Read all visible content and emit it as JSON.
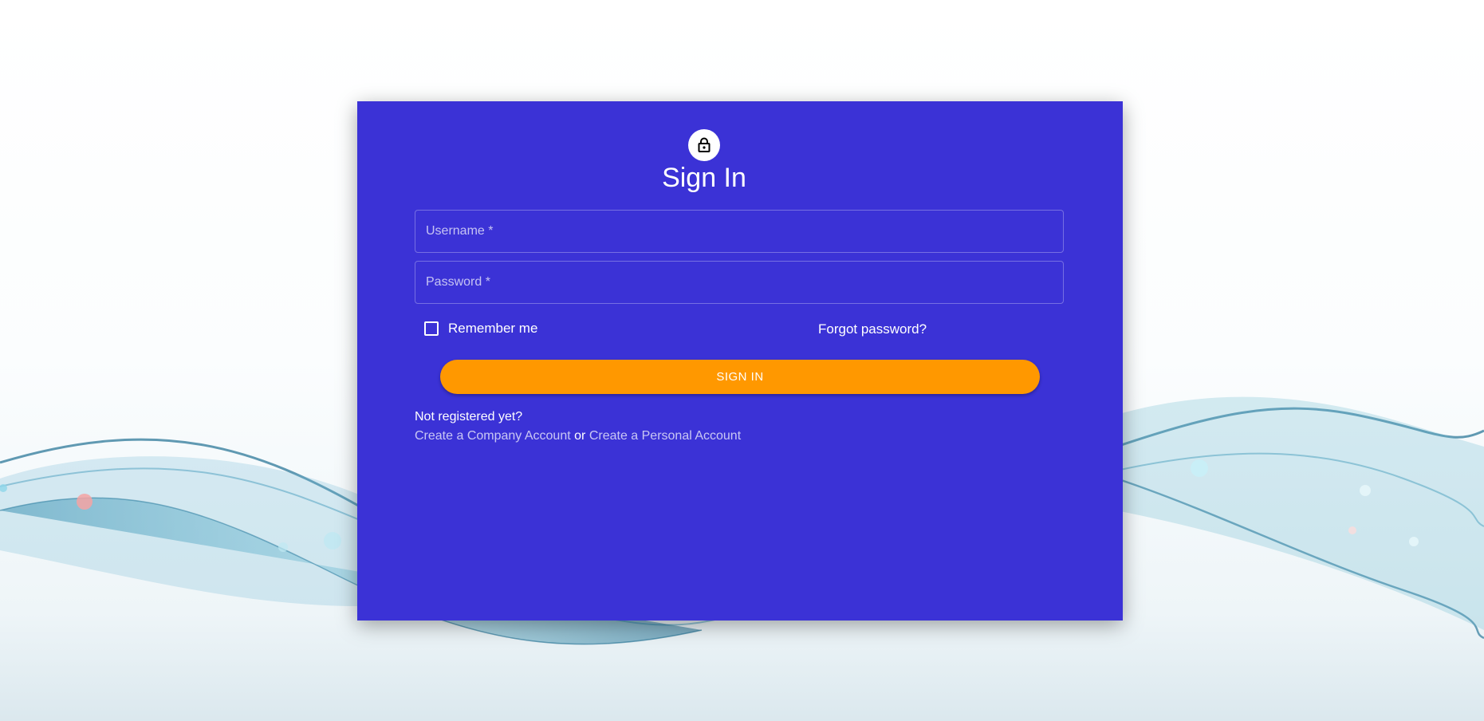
{
  "card": {
    "title": "Sign In",
    "lock_icon": "lock-icon"
  },
  "form": {
    "username_placeholder": "Username *",
    "password_placeholder": "Password *",
    "remember_label": "Remember me",
    "remember_checked": false,
    "forgot_label": "Forgot password?",
    "signin_label": "SIGN IN"
  },
  "register": {
    "prompt": "Not registered yet?",
    "company_link": "Create a Company Account",
    "separator": "or",
    "personal_link": "Create a Personal Account"
  },
  "colors": {
    "card_background": "#3b32d6",
    "button_background": "#ff9800",
    "wave_color": "#1f6f93"
  }
}
